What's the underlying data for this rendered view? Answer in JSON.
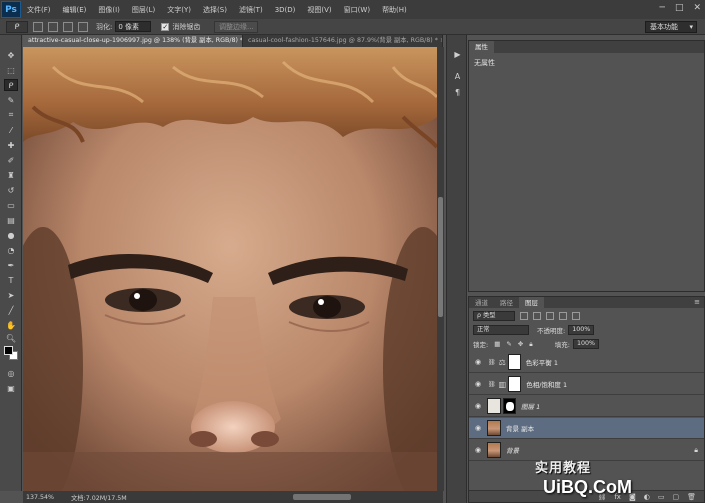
{
  "app": {
    "logo": "Ps"
  },
  "menu": [
    "文件(F)",
    "编辑(E)",
    "图像(I)",
    "图层(L)",
    "文字(Y)",
    "选择(S)",
    "滤镜(T)",
    "3D(D)",
    "视图(V)",
    "窗口(W)",
    "帮助(H)"
  ],
  "window_controls": {
    "minimize": "─",
    "restore": "□",
    "close": "✕"
  },
  "options": {
    "feather_label": "羽化:",
    "feather_value": "0 像素",
    "antialias_label": "消除锯齿",
    "antialias_checked": "✓",
    "refine_edge": "调整边缘...",
    "workspace": "基本功能"
  },
  "doc_tabs": [
    {
      "label": "attractive-casual-close-up-1906997.jpg @ 138% (背景 副本, RGB/8) * ×",
      "active": true
    },
    {
      "label": "casual-cool-fashion-157646.jpg @ 87.9%(背景 副本, RGB/8) * ×",
      "active": false
    }
  ],
  "status": {
    "zoom": "137.54%",
    "doc": "文档:7.02M/17.5M"
  },
  "properties": {
    "tab": "属性",
    "content": "无属性"
  },
  "layers": {
    "tabs": [
      "通道",
      "路径",
      "图层"
    ],
    "filter_kind": "ρ 类型",
    "blend_mode": "正常",
    "opacity_label": "不透明度:",
    "opacity_value": "100%",
    "lock_label": "锁定:",
    "fill_label": "填充:",
    "fill_value": "100%",
    "items": [
      {
        "name": "色彩平衡 1",
        "type": "adjustment"
      },
      {
        "name": "色相/饱和度 1",
        "type": "adjustment"
      },
      {
        "name": "图层 1",
        "type": "masked"
      },
      {
        "name": "背景 副本",
        "type": "photo",
        "selected": true
      },
      {
        "name": "背景",
        "type": "background",
        "locked": true
      }
    ]
  },
  "watermark": {
    "brand": "实用教程",
    "site": "UiBQ.CoM"
  },
  "colors": {
    "accent": "#5d6c80",
    "panel": "#535353",
    "dark": "#3c3c3c"
  }
}
